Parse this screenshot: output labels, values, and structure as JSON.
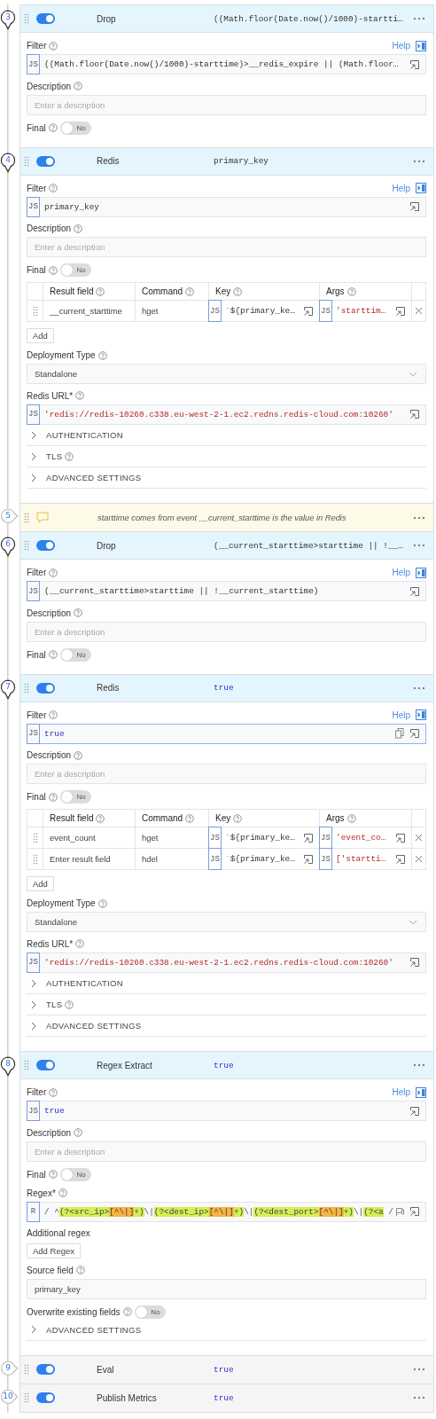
{
  "steps": [
    {
      "number": "3",
      "kind": "function",
      "expanded": true,
      "enabled": true,
      "name": "Drop",
      "summary": {
        "text": "((Math.floor(Date.now()/1000)-startti…",
        "kind": "expression"
      },
      "fields": [
        {
          "kind": "code",
          "label": "Filter",
          "info": true,
          "help": "Help",
          "mode": "JS",
          "value": {
            "text": "((Math.floor(Date.now()/1000)-starttime)>__redis_expire || (Math.floor…",
            "kind": "expression"
          },
          "focused": false
        },
        {
          "kind": "text",
          "label": "Description",
          "info": true,
          "placeholder": "Enter a description"
        },
        {
          "kind": "toggle",
          "label": "Final",
          "info": true,
          "on": false,
          "state_label": "No"
        }
      ]
    },
    {
      "number": "4",
      "kind": "function",
      "expanded": true,
      "enabled": true,
      "name": "Redis",
      "summary": {
        "text": "primary_key",
        "kind": "expression"
      },
      "fields": [
        {
          "kind": "code",
          "label": "Filter",
          "info": true,
          "help": "Help",
          "mode": "JS",
          "value": {
            "text": "primary_key",
            "kind": "expression"
          },
          "focused": false
        },
        {
          "kind": "text",
          "label": "Description",
          "info": true,
          "placeholder": "Enter a description"
        },
        {
          "kind": "toggle",
          "label": "Final",
          "info": true,
          "on": false,
          "state_label": "No"
        },
        {
          "kind": "table",
          "columns": [
            {
              "label": "Result field"
            },
            {
              "label": "Command"
            },
            {
              "label": "Key"
            },
            {
              "label": "Args"
            }
          ],
          "rows": [
            {
              "result_field": {
                "value": "__current_starttime"
              },
              "command": "hget",
              "key": {
                "mode": "JS",
                "value": {
                  "text": "`${primary_ke…",
                  "kind": "expression"
                }
              },
              "args": {
                "mode": "JS",
                "value": {
                  "text": "'starttim…",
                  "kind": "string"
                }
              }
            }
          ],
          "add_button": "Add"
        },
        {
          "kind": "select",
          "label": "Deployment Type",
          "info": true,
          "value": "Standalone"
        },
        {
          "kind": "code",
          "label": "Redis URL*",
          "info": true,
          "mode": "JS",
          "value": {
            "text": "'redis://redis-10260.c338.eu-west-2-1.ec2.redns.redis-cloud.com:10260'",
            "kind": "string"
          },
          "focused": false
        },
        {
          "kind": "sections",
          "items": [
            {
              "label": "AUTHENTICATION",
              "info": false,
              "expanded": false
            },
            {
              "label": "TLS",
              "info": true,
              "expanded": false
            },
            {
              "label": "ADVANCED SETTINGS",
              "info": false,
              "expanded": false
            }
          ]
        }
      ]
    },
    {
      "number": "5",
      "kind": "comment",
      "expanded": false,
      "text": "starttime comes from event __current_starttime is the value in Redis"
    },
    {
      "number": "6",
      "kind": "function",
      "expanded": true,
      "enabled": true,
      "name": "Drop",
      "summary": {
        "text": "(__current_starttime>starttime || !__…",
        "kind": "expression"
      },
      "fields": [
        {
          "kind": "code",
          "label": "Filter",
          "info": true,
          "help": "Help",
          "mode": "JS",
          "value": {
            "text": "(__current_starttime>starttime || !__current_starttime)",
            "kind": "expression"
          },
          "focused": false
        },
        {
          "kind": "text",
          "label": "Description",
          "info": true,
          "placeholder": "Enter a description"
        },
        {
          "kind": "toggle",
          "label": "Final",
          "info": true,
          "on": false,
          "state_label": "No"
        }
      ]
    },
    {
      "number": "7",
      "kind": "function",
      "expanded": true,
      "enabled": true,
      "name": "Redis",
      "summary": {
        "text": "true",
        "kind": "keyword"
      },
      "fields": [
        {
          "kind": "code",
          "label": "Filter",
          "info": true,
          "help": "Help",
          "mode": "JS",
          "value": {
            "text": "true",
            "kind": "keyword"
          },
          "focused": true
        },
        {
          "kind": "text",
          "label": "Description",
          "info": true,
          "placeholder": "Enter a description"
        },
        {
          "kind": "toggle",
          "label": "Final",
          "info": true,
          "on": false,
          "state_label": "No"
        },
        {
          "kind": "table",
          "columns": [
            {
              "label": "Result field"
            },
            {
              "label": "Command"
            },
            {
              "label": "Key"
            },
            {
              "label": "Args"
            }
          ],
          "rows": [
            {
              "result_field": {
                "value": "event_count"
              },
              "command": "hget",
              "key": {
                "mode": "JS",
                "value": {
                  "text": "`${primary_ke…",
                  "kind": "expression"
                }
              },
              "args": {
                "mode": "JS",
                "value": {
                  "text": "'event_co…",
                  "kind": "string"
                }
              }
            },
            {
              "result_field": {
                "placeholder": "Enter result field"
              },
              "command": "hdel",
              "key": {
                "mode": "JS",
                "value": {
                  "text": "`${primary_ke…",
                  "kind": "expression"
                }
              },
              "args": {
                "mode": "JS",
                "value": {
                  "text": "['startti…",
                  "kind": "string"
                }
              }
            }
          ],
          "add_button": "Add"
        },
        {
          "kind": "select",
          "label": "Deployment Type",
          "info": true,
          "value": "Standalone"
        },
        {
          "kind": "code",
          "label": "Redis URL*",
          "info": true,
          "mode": "JS",
          "value": {
            "text": "'redis://redis-10260.c338.eu-west-2-1.ec2.redns.redis-cloud.com:10260'",
            "kind": "string"
          },
          "focused": false
        },
        {
          "kind": "sections",
          "items": [
            {
              "label": "AUTHENTICATION",
              "info": false,
              "expanded": false
            },
            {
              "label": "TLS",
              "info": true,
              "expanded": false
            },
            {
              "label": "ADVANCED SETTINGS",
              "info": false,
              "expanded": false
            }
          ]
        }
      ]
    },
    {
      "number": "8",
      "kind": "function",
      "expanded": true,
      "enabled": true,
      "name": "Regex Extract",
      "summary": {
        "text": "true",
        "kind": "keyword"
      },
      "fields": [
        {
          "kind": "code",
          "label": "Filter",
          "info": true,
          "help": "Help",
          "mode": "JS",
          "value": {
            "text": "true",
            "kind": "keyword"
          },
          "focused": false
        },
        {
          "kind": "text",
          "label": "Description",
          "info": true,
          "placeholder": "Enter a description"
        },
        {
          "kind": "toggle",
          "label": "Final",
          "info": true,
          "on": false,
          "state_label": "No"
        },
        {
          "kind": "regex",
          "label": "Regex*",
          "info": true,
          "mode": "R",
          "open": "/",
          "close": "/",
          "segments": [
            {
              "kind": "plain",
              "text": "^"
            },
            {
              "kind": "group",
              "text": "(?<src_ip>"
            },
            {
              "kind": "class",
              "text": "[^\\|]"
            },
            {
              "kind": "group",
              "text": "+)"
            },
            {
              "kind": "plain",
              "text": "\\|"
            },
            {
              "kind": "group",
              "text": "(?<dest_ip>"
            },
            {
              "kind": "class",
              "text": "[^\\|]"
            },
            {
              "kind": "group",
              "text": "+)"
            },
            {
              "kind": "plain",
              "text": "\\|"
            },
            {
              "kind": "group",
              "text": "(?<dest_port>"
            },
            {
              "kind": "class",
              "text": "[^\\|]"
            },
            {
              "kind": "group",
              "text": "+)"
            },
            {
              "kind": "plain",
              "text": "\\|"
            },
            {
              "kind": "group",
              "text": "(?<a"
            }
          ]
        },
        {
          "kind": "button",
          "label": "Additional regex",
          "info": false,
          "button": "Add Regex"
        },
        {
          "kind": "text",
          "label": "Source field",
          "info": true,
          "value": "primary_key"
        },
        {
          "kind": "toggle",
          "label": "Overwrite existing fields",
          "info": true,
          "on": false,
          "state_label": "No"
        },
        {
          "kind": "sections",
          "items": [
            {
              "label": "ADVANCED SETTINGS",
              "info": false,
              "expanded": false
            }
          ]
        }
      ]
    },
    {
      "number": "9",
      "kind": "function",
      "expanded": false,
      "enabled": true,
      "name": "Eval",
      "summary": {
        "text": "true",
        "kind": "keyword"
      }
    },
    {
      "number": "10",
      "kind": "function",
      "expanded": false,
      "enabled": true,
      "name": "Publish Metrics",
      "summary": {
        "text": "true",
        "kind": "keyword"
      }
    }
  ]
}
